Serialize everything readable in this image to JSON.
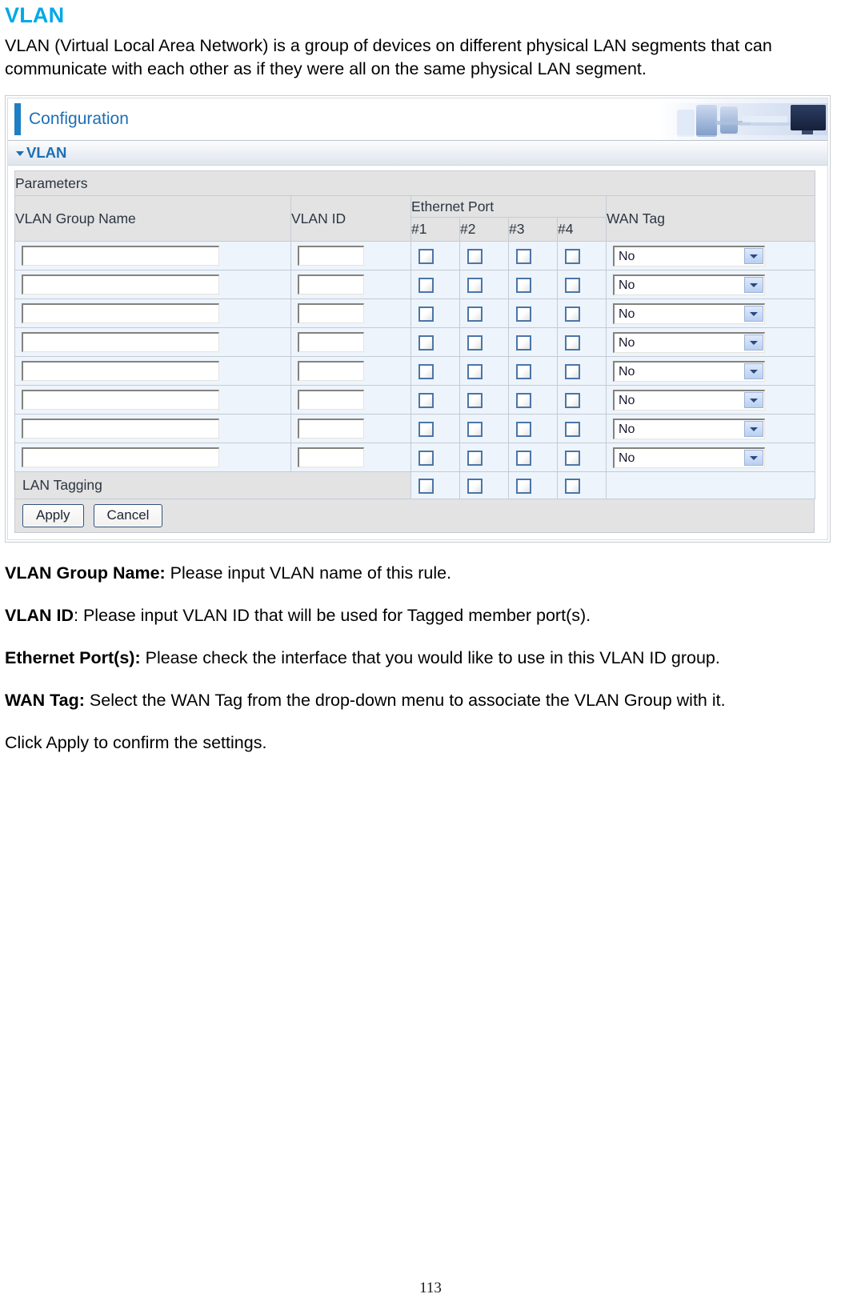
{
  "page": {
    "title": "VLAN",
    "intro": "VLAN (Virtual Local Area Network) is a group of devices on different physical LAN segments that can communicate with each other as if they were all on the same physical LAN segment.",
    "page_number": "113",
    "title_color": "#00a8e8"
  },
  "ui": {
    "header_title": "Configuration",
    "section_title": "VLAN",
    "parameters_label": "Parameters",
    "columns": {
      "group_name": "VLAN Group Name",
      "vlan_id": "VLAN ID",
      "ethernet_port": "Ethernet Port",
      "wan_tag": "WAN Tag"
    },
    "ports": [
      "#1",
      "#2",
      "#3",
      "#4"
    ],
    "lan_tagging_label": "LAN Tagging",
    "buttons": {
      "apply": "Apply",
      "cancel": "Cancel"
    },
    "wan_tag_options": [
      "No"
    ],
    "rows": [
      {
        "group_name": "",
        "vlan_id": "",
        "ports": [
          false,
          false,
          false,
          false
        ],
        "wan_tag": "No"
      },
      {
        "group_name": "",
        "vlan_id": "",
        "ports": [
          false,
          false,
          false,
          false
        ],
        "wan_tag": "No"
      },
      {
        "group_name": "",
        "vlan_id": "",
        "ports": [
          false,
          false,
          false,
          false
        ],
        "wan_tag": "No"
      },
      {
        "group_name": "",
        "vlan_id": "",
        "ports": [
          false,
          false,
          false,
          false
        ],
        "wan_tag": "No"
      },
      {
        "group_name": "",
        "vlan_id": "",
        "ports": [
          false,
          false,
          false,
          false
        ],
        "wan_tag": "No"
      },
      {
        "group_name": "",
        "vlan_id": "",
        "ports": [
          false,
          false,
          false,
          false
        ],
        "wan_tag": "No"
      },
      {
        "group_name": "",
        "vlan_id": "",
        "ports": [
          false,
          false,
          false,
          false
        ],
        "wan_tag": "No"
      },
      {
        "group_name": "",
        "vlan_id": "",
        "ports": [
          false,
          false,
          false,
          false
        ],
        "wan_tag": "No"
      }
    ],
    "lan_tagging_ports": [
      false,
      false,
      false,
      false
    ]
  },
  "descriptions": [
    {
      "term": "VLAN Group Name:",
      "text": " Please input VLAN name of this rule."
    },
    {
      "term": "VLAN ID",
      "text": ": Please input VLAN ID that will be used for Tagged member port(s)."
    },
    {
      "term": "Ethernet Port(s):",
      "text": " Please check the interface that you would like to use in this VLAN ID group."
    },
    {
      "term": "WAN Tag:",
      "text": " Select the WAN Tag from the drop-down menu to associate the VLAN Group with it."
    },
    {
      "term": "",
      "text": "Click Apply to confirm the settings."
    }
  ]
}
